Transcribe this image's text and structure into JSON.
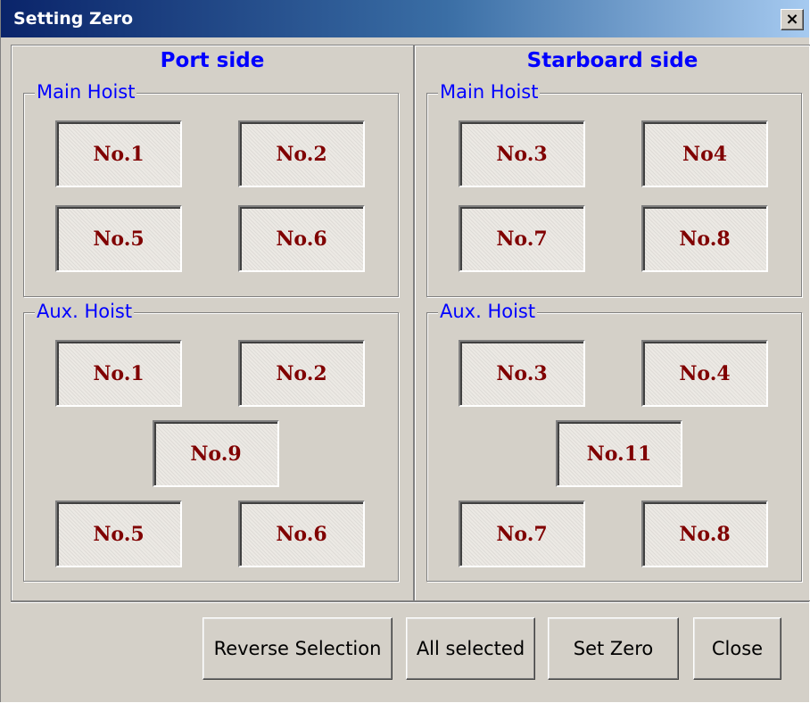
{
  "window": {
    "title": "Setting Zero",
    "close_glyph": "×"
  },
  "port": {
    "title": "Port side",
    "main": {
      "legend": "Main Hoist",
      "buttons": [
        "No.1",
        "No.2",
        "No.5",
        "No.6"
      ]
    },
    "aux": {
      "legend": "Aux. Hoist",
      "buttons": [
        "No.1",
        "No.2",
        "No.9",
        "No.5",
        "No.6"
      ]
    }
  },
  "starboard": {
    "title": "Starboard side",
    "main": {
      "legend": "Main Hoist",
      "buttons": [
        "No.3",
        "No4",
        "No.7",
        "No.8"
      ]
    },
    "aux": {
      "legend": "Aux. Hoist",
      "buttons": [
        "No.3",
        "No.4",
        "No.11",
        "No.7",
        "No.8"
      ]
    }
  },
  "actions": {
    "reverse": "Reverse Selection",
    "all": "All selected",
    "set_zero": "Set Zero",
    "close": "Close"
  },
  "colors": {
    "legend_text": "#0000ff",
    "hoist_text": "#800000",
    "face": "#d4d0c8"
  }
}
